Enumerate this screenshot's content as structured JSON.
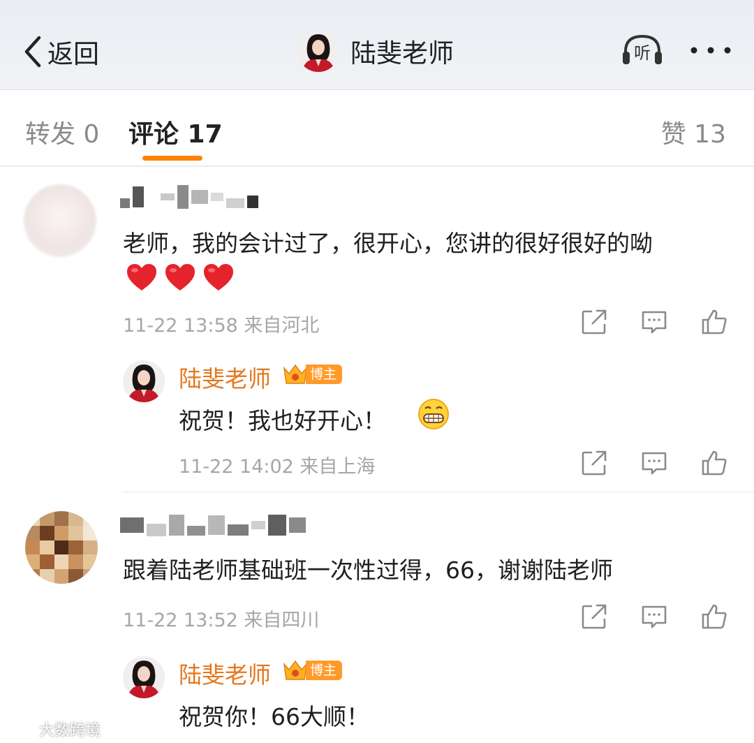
{
  "nav": {
    "back_label": "返回",
    "title": "陆斐老师",
    "listen_label": "听"
  },
  "tabs": {
    "forward": "转发 0",
    "comments": "评论 17",
    "likes": "赞 13"
  },
  "comments": [
    {
      "text_line1": "老师，我的会计过了，很开心，您讲的很好很好的呦",
      "emoji": [
        "heart",
        "heart",
        "heart"
      ],
      "meta": "11-22 13:58 来自河北",
      "reply": {
        "name": "陆斐老师",
        "badge": "博主",
        "text": "祝贺！我也好开心！",
        "emoji": "grin",
        "meta": "11-22 14:02 来自上海"
      }
    },
    {
      "text_line1": "跟着陆老师基础班一次性过得，66，谢谢陆老师",
      "meta": "11-22 13:52 来自四川",
      "reply": {
        "name": "陆斐老师",
        "badge": "博主",
        "text": "祝贺你！66大顺！"
      }
    }
  ],
  "watermark": "大数跨境",
  "colors": {
    "accent": "#ff8200",
    "reply_name": "#e4781e",
    "meta": "#a6a6a6"
  },
  "icons": [
    "back-chevron-icon",
    "listen-headphones-icon",
    "more-dots-icon",
    "repost-icon",
    "comment-icon",
    "like-icon",
    "crown-icon",
    "heart-emoji",
    "grin-emoji"
  ]
}
